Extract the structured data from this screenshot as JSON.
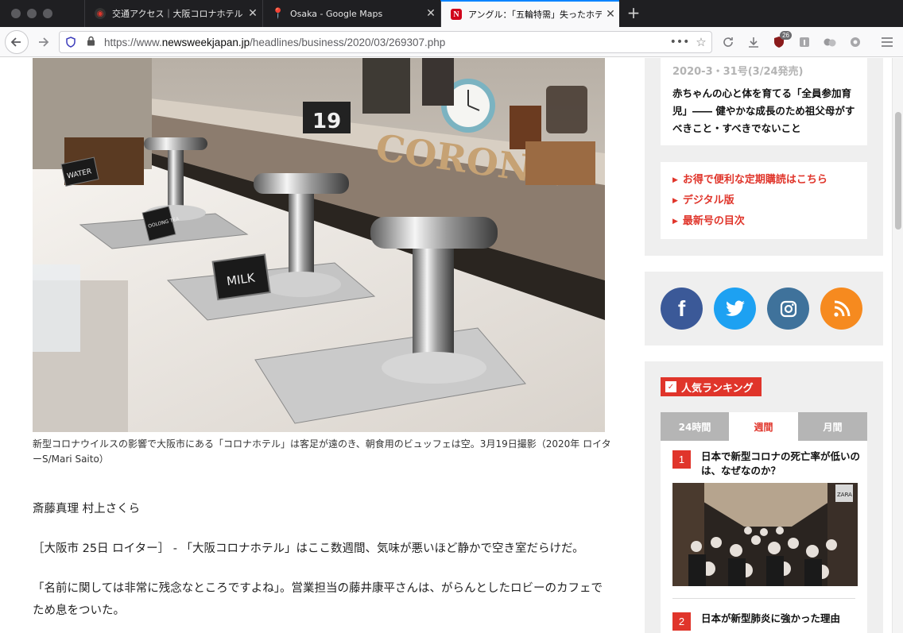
{
  "browser": {
    "tabs": [
      {
        "title": "交通アクセス｜大阪コロナホテル 新",
        "close": "✕"
      },
      {
        "title": "Osaka - Google Maps",
        "close": "✕"
      },
      {
        "title": "アングル：「五輪特需」失ったホテル",
        "close": "✕"
      }
    ],
    "new_tab": "+",
    "url_prefix": "https://www.",
    "url_domain": "newsweekjapan.jp",
    "url_path": "/headlines/business/2020/03/269307.php",
    "url_more": "•••",
    "addon_badge": "26",
    "icons": {
      "back": "arrow-left-icon",
      "forward": "arrow-right-icon",
      "reload": "reload-icon",
      "download": "download-icon",
      "menu": "hamburger-icon"
    }
  },
  "article": {
    "caption": "新型コロナウイルスの影響で大阪市にある「コロナホテル」は客足が遠のき、朝食用のビュッフェは空。3月19日撮影（2020年 ロイターS/Mari Saito）",
    "byline": "斎藤真理 村上さくら",
    "para1": "［大阪市 25日 ロイター］ - 「大阪コロナホテル」はここ数週間、気味が悪いほど静かで空き室だらけだ。",
    "para2": "「名前に関しては非常に残念なところですよね」。営業担当の藤井康平さんは、がらんとしたロビーのカフェでため息をついた。",
    "photo_signs": {
      "corona": "CORONA",
      "milk": "MILK",
      "water": "WATER",
      "oolong": "OOLONG TEA",
      "clock": "19"
    }
  },
  "sidebar": {
    "issue_date": "2020-3・31号(3/24発売)",
    "issue_title": "赤ちゃんの心と体を育てる「全員参加育児」―― 健やかな成長のため祖父母がすべきこと・すべきでないこと",
    "links": [
      {
        "label": "お得で便利な定期購読はこちら"
      },
      {
        "label": "デジタル版"
      },
      {
        "label": "最新号の目次"
      }
    ],
    "social": [
      {
        "name": "facebook",
        "glyph": "f",
        "color": "#3b5998"
      },
      {
        "name": "twitter",
        "glyph": "🐦",
        "color": "#1da1f2"
      },
      {
        "name": "instagram",
        "glyph": "◎",
        "color": "#3f729b"
      },
      {
        "name": "rss",
        "glyph": "))",
        "color": "#f68a1f"
      }
    ],
    "ranking_title": "人気ランキング",
    "ranking_tabs": [
      "24時間",
      "週間",
      "月間"
    ],
    "ranking_items": [
      {
        "num": "1",
        "title": "日本で新型コロナの死亡率が低いのは、なぜなのか？"
      },
      {
        "num": "2",
        "title": "日本が新型肺炎に強かった理由"
      }
    ],
    "zara_sign": "ZARA"
  },
  "colors": {
    "accent": "#e0352b",
    "sidebar_bg": "#efefef"
  }
}
